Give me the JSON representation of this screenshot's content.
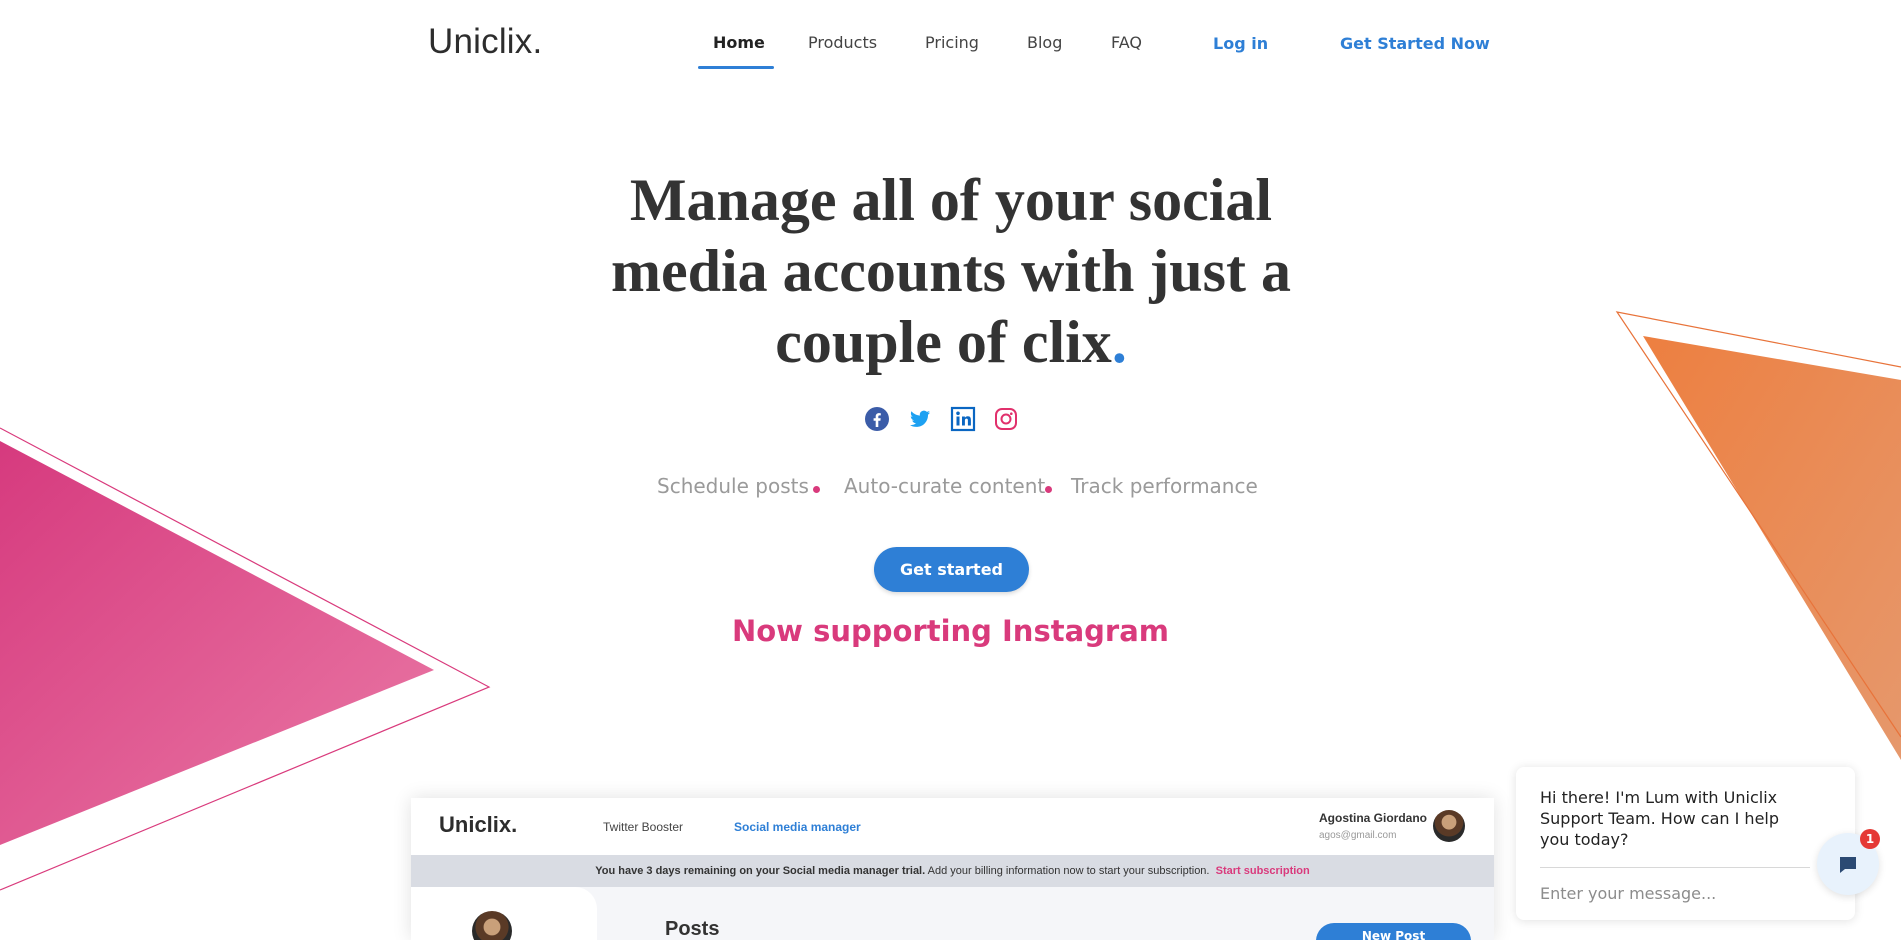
{
  "header": {
    "logo": "Uniclix.",
    "nav": {
      "home": "Home",
      "products": "Products",
      "pricing": "Pricing",
      "blog": "Blog",
      "faq": "FAQ",
      "login": "Log in",
      "get_started_now": "Get Started Now"
    }
  },
  "hero": {
    "title_text": "Manage all of your social media accounts with just a couple of clix",
    "title_dot": ".",
    "social_icons": [
      "facebook-icon",
      "twitter-icon",
      "linkedin-icon",
      "instagram-icon"
    ],
    "features": [
      "Schedule posts",
      "Auto-curate content",
      "Track performance"
    ],
    "cta_label": "Get started",
    "announcement": "Now supporting Instagram"
  },
  "preview": {
    "logo": "Uniclix.",
    "tabs": [
      "Twitter Booster",
      "Social media manager"
    ],
    "user_name": "Agostina Giordano",
    "user_email": "agos@gmail.com",
    "banner_bold": "You have 3 days remaining on your Social media manager trial.",
    "banner_text": "Add your billing information now to start your subscription.",
    "banner_link": "Start subscription",
    "section_title": "Posts",
    "new_post_label": "New Post"
  },
  "chat": {
    "message": "Hi there! I'm Lum with Uniclix Support Team. How can I help you today?",
    "placeholder": "Enter your message...",
    "unread_count": "1"
  },
  "colors": {
    "brand_blue": "#2e7fd6",
    "accent_pink": "#d93a7c",
    "accent_orange": "#ee8148"
  }
}
